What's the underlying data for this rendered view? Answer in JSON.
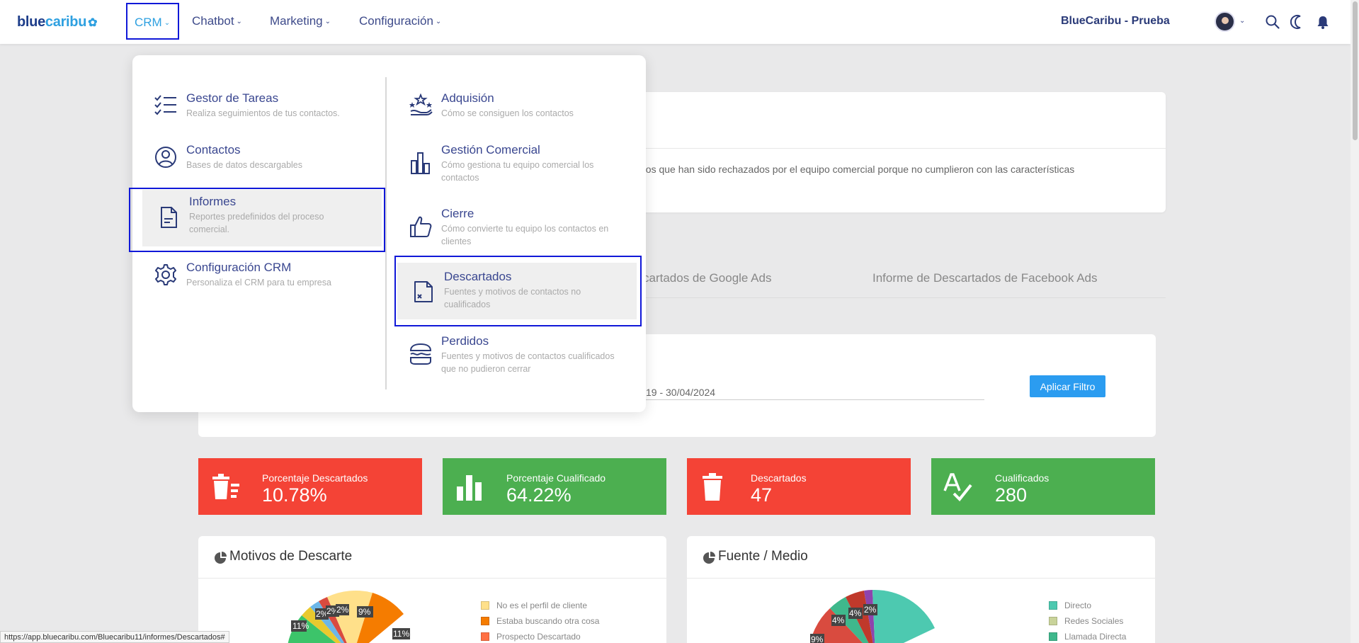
{
  "topbar": {
    "logo_part1": "blue",
    "logo_part2": "caribu",
    "nav": [
      {
        "label": "CRM"
      },
      {
        "label": "Chatbot"
      },
      {
        "label": "Marketing"
      },
      {
        "label": "Configuración"
      }
    ],
    "account_name": "BlueCaribu - Prueba",
    "icons": [
      "avatar",
      "search-icon",
      "moon-icon",
      "bell-icon"
    ]
  },
  "crm_menu": {
    "left": [
      {
        "title": "Gestor de Tareas",
        "desc": "Realiza seguimientos de tus contactos.",
        "icon": "tasks-icon"
      },
      {
        "title": "Contactos",
        "desc": "Bases de datos descargables",
        "icon": "user-circle-icon"
      },
      {
        "title": "Informes",
        "desc": "Reportes predefinidos del proceso comercial.",
        "icon": "report-icon",
        "selected": true
      },
      {
        "title": "Configuración CRM",
        "desc": "Personaliza el CRM para tu empresa",
        "icon": "gear-icon"
      }
    ],
    "right": [
      {
        "title": "Adquisión",
        "desc": "Cómo se consiguen los contactos",
        "icon": "acquisition-icon"
      },
      {
        "title": "Gestión Comercial",
        "desc": "Cómo gestiona tu equipo comercial los contactos",
        "icon": "bar-chart-icon"
      },
      {
        "title": "Cierre",
        "desc": "Cómo convierte tu equipo los contactos en clientes",
        "icon": "thumbs-up-icon"
      },
      {
        "title": "Descartados",
        "desc": "Fuentes y motivos de contactos no cualificados",
        "icon": "discarded-doc-icon",
        "selected": true
      },
      {
        "title": "Perdidos",
        "desc": "Fuentes y motivos de contactos cualificados que no pudieron cerrar",
        "icon": "lost-icon"
      }
    ]
  },
  "info_card": {
    "text": "dos que han sido rechazados por el equipo comercial porque no cumplieron con las características"
  },
  "tabs": [
    {
      "label": "cartados de Google Ads"
    },
    {
      "label": "Informe de Descartados de Facebook Ads"
    }
  ],
  "filter": {
    "date_range": "19 - 30/04/2024",
    "apply_label": "Aplicar Filtro"
  },
  "stats": [
    {
      "label": "Porcentaje Descartados",
      "value": "10.78%",
      "color": "#f44336",
      "icon": "trash-list-icon"
    },
    {
      "label": "Porcentaje Cualificado",
      "value": "64.22%",
      "color": "#4caf50",
      "icon": "bar-chart-icon"
    },
    {
      "label": "Descartados",
      "value": "47",
      "color": "#f44336",
      "icon": "trash-icon"
    },
    {
      "label": "Cualificados",
      "value": "280",
      "color": "#4caf50",
      "icon": "spellcheck-icon"
    }
  ],
  "charts": {
    "motivos": {
      "title": "Motivos de Descarte",
      "legend": [
        {
          "label": "No es el perfil de cliente",
          "color": "#ffe08a"
        },
        {
          "label": "Estaba buscando otra cosa",
          "color": "#f57c00"
        },
        {
          "label": "Prospecto Descartado",
          "color": "#ff7043"
        }
      ],
      "labels": [
        "11%",
        "2%",
        "2%",
        "2%",
        "9%",
        "11%"
      ]
    },
    "fuente": {
      "title": "Fuente / Medio",
      "legend": [
        {
          "label": "Directo",
          "color": "#4dc9b0"
        },
        {
          "label": "Redes Sociales",
          "color": "#c9d39a"
        },
        {
          "label": "Llamada Directa",
          "color": "#3fb88c"
        }
      ],
      "labels": [
        "9%",
        "4%",
        "4%",
        "2%"
      ]
    }
  },
  "status_url": "https://app.bluecaribu.com/Bluecaribu11/informes/Descartados#"
}
